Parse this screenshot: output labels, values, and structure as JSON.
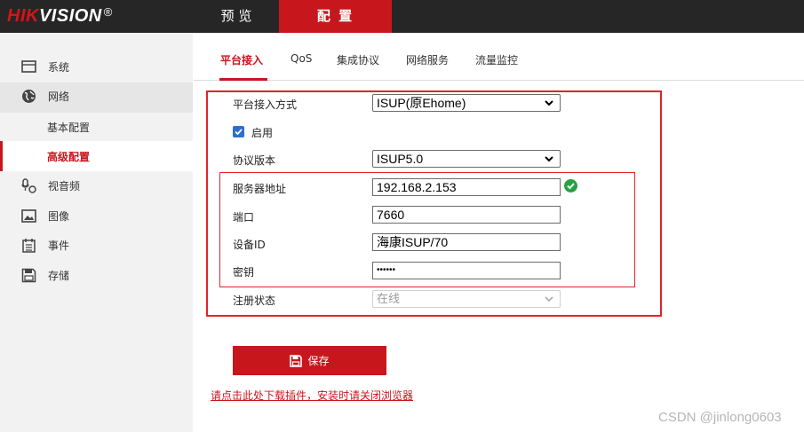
{
  "brand": {
    "part1": "HIK",
    "part2": "VISION",
    "reg": "®"
  },
  "top_nav": [
    {
      "label": "预 览"
    },
    {
      "label": "配 置"
    }
  ],
  "sidebar": {
    "items": [
      {
        "label": "系统",
        "icon": "monitor-icon"
      },
      {
        "label": "网络",
        "icon": "globe-icon"
      },
      {
        "label": "基本配置"
      },
      {
        "label": "高级配置"
      },
      {
        "label": "视音频",
        "icon": "camera-mic-icon"
      },
      {
        "label": "图像",
        "icon": "image-icon"
      },
      {
        "label": "事件",
        "icon": "calendar-icon"
      },
      {
        "label": "存储",
        "icon": "save-disk-icon"
      }
    ]
  },
  "tabs": [
    {
      "label": "平台接入"
    },
    {
      "label": "QoS"
    },
    {
      "label": "集成协议"
    },
    {
      "label": "网络服务"
    },
    {
      "label": "流量监控"
    }
  ],
  "form": {
    "access_mode": {
      "label": "平台接入方式",
      "value": "ISUP(原Ehome)"
    },
    "enable": {
      "label": "启用",
      "checked": true
    },
    "protocol_version": {
      "label": "协议版本",
      "value": "ISUP5.0"
    },
    "server_address": {
      "label": "服务器地址",
      "value": "192.168.2.153"
    },
    "port": {
      "label": "端口",
      "value": "7660"
    },
    "device_id": {
      "label": "设备ID",
      "value": "海康ISUP/70"
    },
    "key": {
      "label": "密钥",
      "value": "••••••"
    },
    "register_status": {
      "label": "注册状态",
      "value": "在线"
    }
  },
  "save_button": {
    "label": "保存"
  },
  "plugin_link": {
    "label": "请点击此处下载插件，安装时请关闭浏览器"
  },
  "watermark": {
    "text": "CSDN @jinlong0603"
  },
  "colors": {
    "accent": "#c8161d",
    "highlight_box": "#e5212a",
    "topbar": "#262626",
    "ok": "#26a144"
  }
}
